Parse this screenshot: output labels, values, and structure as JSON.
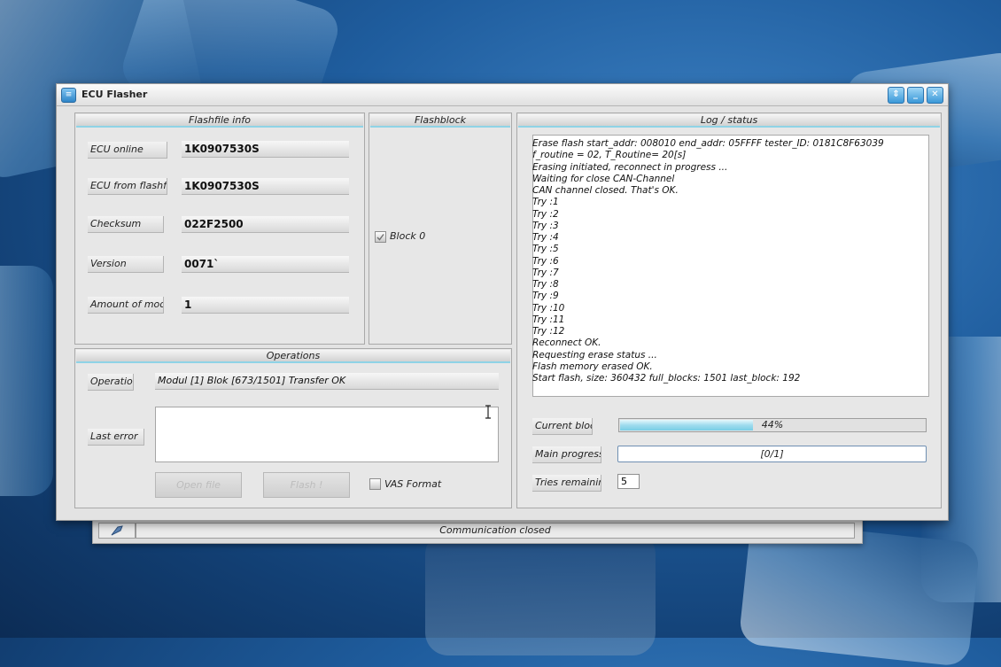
{
  "window": {
    "title": "ECU Flasher"
  },
  "flashfile_info": {
    "heading": "Flashfile info",
    "rows": [
      {
        "label": "ECU online",
        "value": "1K0907530S"
      },
      {
        "label": "ECU from flashfile",
        "value": "1K0907530S"
      },
      {
        "label": "Checksum",
        "value": "022F2500"
      },
      {
        "label": "Version",
        "value": "0071`"
      },
      {
        "label": "Amount of modules",
        "value": "1"
      }
    ]
  },
  "flashblock": {
    "heading": "Flashblock",
    "block_label": "Block 0",
    "block_checked": true
  },
  "log": {
    "heading": "Log / status",
    "lines": [
      "Erase flash start_addr: 008010 end_addr: 05FFFF tester_ID: 0181C8F63039",
      "f_routine = 02, T_Routine= 20[s]",
      "Erasing initiated, reconnect in progress ...",
      "Waiting for close CAN-Channel",
      "CAN channel closed. That's OK.",
      "Try :1",
      "Try :2",
      "Try :3",
      "Try :4",
      "Try :5",
      "Try :6",
      "Try :7",
      "Try :8",
      "Try :9",
      "Try :10",
      "Try :11",
      "Try :12",
      "Reconnect OK.",
      "Requesting erase status ...",
      "Flash memory erased OK.",
      "Start flash, size: 360432 full_blocks: 1501 last_block: 192"
    ]
  },
  "operations": {
    "heading": "Operations",
    "operation_label": "Operation",
    "operation_value": "Modul [1] Blok [673/1501] Transfer OK",
    "last_error_label": "Last error",
    "last_error_value": "",
    "open_file_label": "Open file",
    "flash_label": "Flash !",
    "vas_format_label": "VAS Format",
    "vas_format_checked": false
  },
  "progress": {
    "current_block_label": "Current block",
    "current_block_percent": 44,
    "current_block_text": "44%",
    "main_progress_label": "Main progress",
    "main_progress_text": "[0/1]",
    "main_progress_fraction": 0,
    "tries_remaining_label": "Tries remaining",
    "tries_remaining_value": "5"
  },
  "statusbar": {
    "text": "Communication closed"
  },
  "colors": {
    "accent": "#8fd3e6",
    "progress_fill": "#78cde5",
    "title_button": "#3a98d8"
  }
}
